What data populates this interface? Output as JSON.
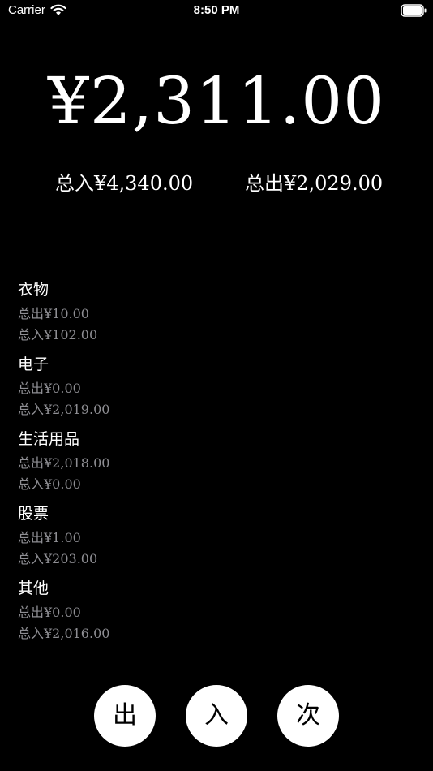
{
  "status_bar": {
    "carrier": "Carrier",
    "time": "8:50 PM",
    "icons": [
      "wifi-icon",
      "battery-icon"
    ]
  },
  "summary": {
    "balance": "¥2,311.00",
    "total_in": "总入¥4,340.00",
    "total_out": "总出¥2,029.00"
  },
  "categories": [
    {
      "name": "衣物",
      "out": "总出¥10.00",
      "in": "总入¥102.00"
    },
    {
      "name": "电子",
      "out": "总出¥0.00",
      "in": "总入¥2,019.00"
    },
    {
      "name": "生活用品",
      "out": "总出¥2,018.00",
      "in": "总入¥0.00"
    },
    {
      "name": "股票",
      "out": "总出¥1.00",
      "in": "总入¥203.00"
    },
    {
      "name": "其他",
      "out": "总出¥0.00",
      "in": "总入¥2,016.00"
    }
  ],
  "actions": {
    "out_label": "出",
    "in_label": "入",
    "count_label": "次"
  },
  "colors": {
    "background": "#000000",
    "text": "#ffffff",
    "secondary_text": "#8e8e93",
    "button_bg": "#ffffff",
    "button_text": "#000000"
  }
}
